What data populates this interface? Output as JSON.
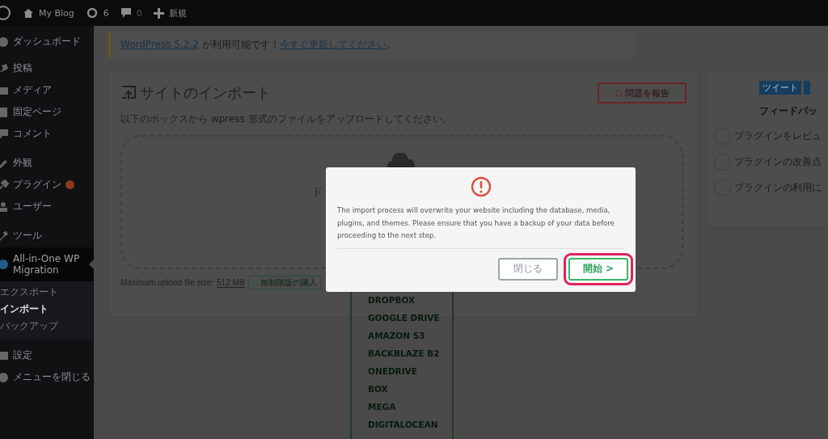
{
  "admin_bar": {
    "site": "My Blog",
    "updates": "6",
    "comments": "0",
    "new": "新規"
  },
  "sidebar": {
    "items": [
      {
        "label": "ダッシュボード",
        "selected": false,
        "badge": false
      },
      {
        "label": "投稿",
        "selected": false,
        "badge": false
      },
      {
        "label": "メディア",
        "selected": false,
        "badge": false
      },
      {
        "label": "固定ページ",
        "selected": false,
        "badge": false
      },
      {
        "label": "コメント",
        "selected": false,
        "badge": false
      },
      {
        "label": "外観",
        "selected": false,
        "badge": false
      },
      {
        "label": "プラグイン",
        "selected": false,
        "badge": true
      },
      {
        "label": "ユーザー",
        "selected": false,
        "badge": false
      },
      {
        "label": "ツール",
        "selected": false,
        "badge": false
      },
      {
        "label": "All-in-One WP Migration",
        "selected": true,
        "badge": false,
        "children": [
          {
            "label": "エクスポート",
            "selected": false
          },
          {
            "label": "インポート",
            "selected": true
          },
          {
            "label": "バックアップ",
            "selected": false
          }
        ]
      },
      {
        "label": "設定",
        "selected": false,
        "badge": false
      },
      {
        "label": "メニューを閉じる",
        "selected": false,
        "badge": false
      }
    ]
  },
  "notice": {
    "version_link": "WordPress 5.2.2",
    "text": " が利用可能です！",
    "update_link": "今すぐ更新してください",
    "end": "。"
  },
  "import_panel": {
    "title": "サイトのインポート",
    "report_button": "問題を報告",
    "description": "以下のボックスから wpress 形式のファイルをアップロードしてください。",
    "drop_text": "ド",
    "max_label": "Maximum upload file size:",
    "max_value": "512 MB",
    "buy_button": "無制限版の購入",
    "import_options": [
      "DROPBOX",
      "GOOGLE DRIVE",
      "AMAZON S3",
      "BACKBLAZE B2",
      "ONEDRIVE",
      "BOX",
      "MEGA",
      "DIGITALOCEAN"
    ]
  },
  "side_panel": {
    "tweet_button": "ツイート",
    "title": "フィードバッ",
    "options": [
      {
        "label": "プラグインをレビュ",
        "selected": false
      },
      {
        "label": "プラグインの改善点",
        "selected": false
      },
      {
        "label": "プラグインの利用に",
        "selected": false
      }
    ]
  },
  "modal": {
    "message": "The import process will overwrite your website including the database, media, plugins, and themes. Please ensure that you have a backup of your data before proceeding to the next step.",
    "buttons": [
      {
        "label": "閉じる",
        "kind": "secondary",
        "highlighted": false
      },
      {
        "label": "開始 >",
        "kind": "primary",
        "highlighted": true
      }
    ]
  }
}
